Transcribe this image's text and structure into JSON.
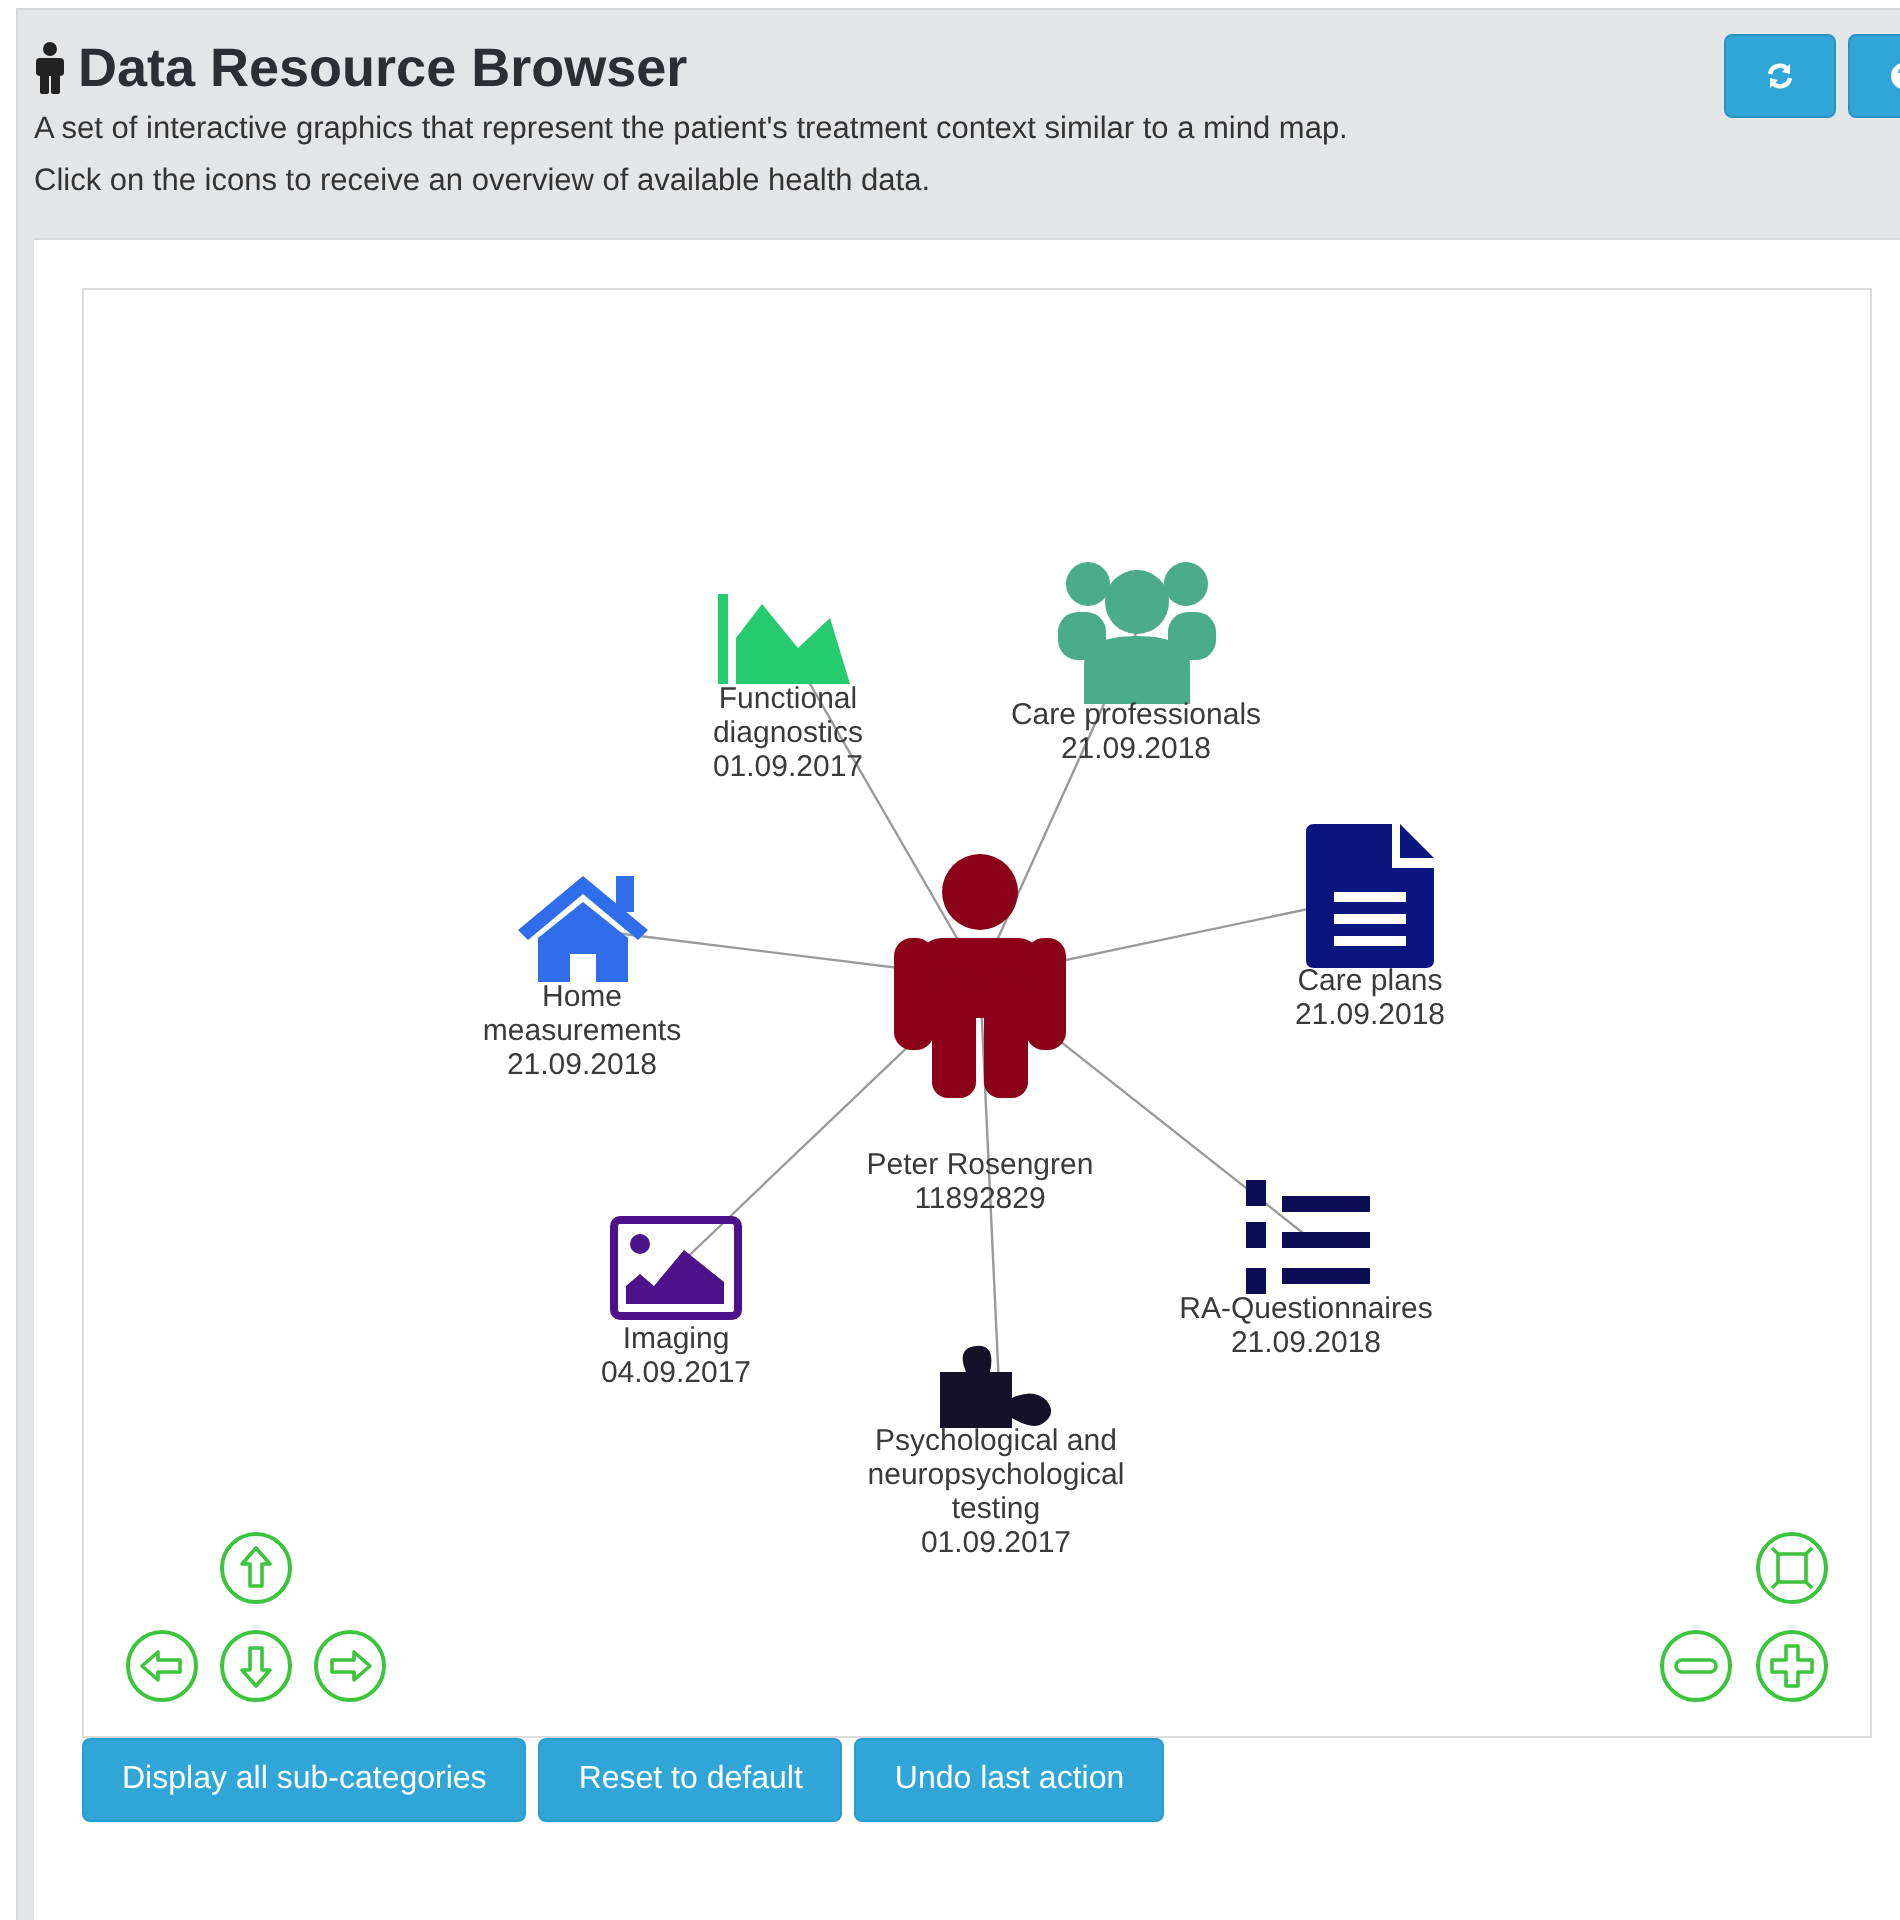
{
  "header": {
    "title": "Data Resource Browser",
    "description": [
      "A set of interactive graphics that represent the patient's treatment context similar to a mind map.",
      "Click on the icons to receive an overview of available health data."
    ]
  },
  "network": {
    "center": {
      "lines": [
        "Peter Rosengren",
        "11892829"
      ]
    },
    "nodes": [
      {
        "kind": "functional",
        "lines": [
          "Functional",
          "diagnostics",
          "01.09.2017"
        ]
      },
      {
        "kind": "professionals",
        "lines": [
          "Care professionals",
          "21.09.2018"
        ]
      },
      {
        "kind": "plans",
        "lines": [
          "Care plans",
          "21.09.2018"
        ]
      },
      {
        "kind": "home",
        "lines": [
          "Home",
          "measurements",
          "21.09.2018"
        ]
      },
      {
        "kind": "imaging",
        "lines": [
          "Imaging",
          "04.09.2017"
        ]
      },
      {
        "kind": "psych",
        "lines": [
          "Psychological and",
          "neuropsychological",
          "testing",
          "01.09.2017"
        ]
      },
      {
        "kind": "questionnaires",
        "lines": [
          "RA-Questionnaires",
          "21.09.2018"
        ]
      }
    ]
  },
  "actions": [
    "Display all sub-categories",
    "Reset to default",
    "Undo last action"
  ]
}
